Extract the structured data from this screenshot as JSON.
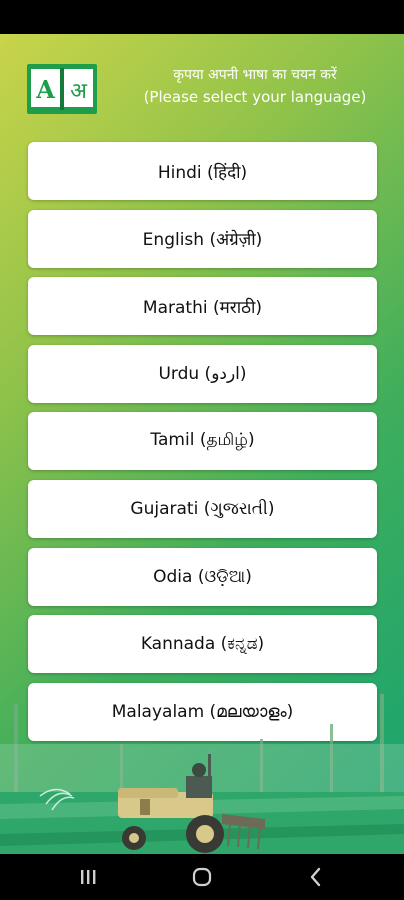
{
  "header": {
    "logo_letter_latin": "A",
    "logo_letter_devanagari": "अ",
    "prompt_hindi": "कृपया अपनी भाषा का चयन करें",
    "prompt_english": "(Please select your language)"
  },
  "languages": [
    {
      "label": "Hindi (हिंदी)"
    },
    {
      "label": "English (अंग्रेज़ी)"
    },
    {
      "label": "Marathi (मराठी)"
    },
    {
      "label": "Urdu (اردو)"
    },
    {
      "label": "Tamil (தமிழ்)"
    },
    {
      "label": "Gujarati (ગુજરાતી)"
    },
    {
      "label": "Odia (ଓଡ଼ିଆ)"
    },
    {
      "label": "Kannada (ಕನ್ನಡ)"
    },
    {
      "label": "Malayalam (മലയാളം)"
    }
  ],
  "colors": {
    "gradient_start": "#c9d44a",
    "gradient_end": "#16a371",
    "logo_green": "#1e9e4a",
    "button_bg": "#ffffff"
  },
  "icons": {
    "logo": "language-book-icon",
    "nav_recent": "recent-apps-icon",
    "nav_home": "home-icon",
    "nav_back": "back-icon"
  }
}
